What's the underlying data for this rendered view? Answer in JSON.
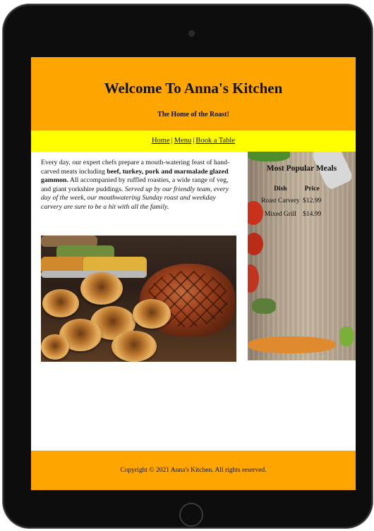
{
  "header": {
    "title": "Welcome To Anna's Kitchen",
    "tagline": "The Home of the Roast!"
  },
  "nav": {
    "items": [
      {
        "label": "Home"
      },
      {
        "label": "Menu"
      },
      {
        "label": "Book a Table"
      }
    ],
    "separator": "|"
  },
  "intro": {
    "part1": "Every day, our expert chefs prepare a mouth-watering feast of hand-carved meats including ",
    "bold_meats": "beef, turkey, pork and marmalade glazed gammon.",
    "part2": " All accompanied by ruffled roasties, a wide range of veg, and giant yorkshire puddings. ",
    "italic_text": "Served up by our friendly team, every day of the week, our mouthwatering Sunday roast and weekday carvery are sure to be a hit with all the family."
  },
  "sidebar": {
    "title": "Most Popular Meals",
    "columns": [
      "Dish",
      "Price"
    ],
    "rows": [
      {
        "dish": "Roast Carvery",
        "price": "$12.99"
      },
      {
        "dish": "Mixed Grill",
        "price": "$14.99"
      }
    ]
  },
  "footer": {
    "copyright": "Copyright © 2021 Anna's Kitchen. All rights reserved."
  },
  "colors": {
    "header_bg": "#ffa500",
    "nav_bg": "#ffff00",
    "footer_bg": "#ffa500"
  }
}
